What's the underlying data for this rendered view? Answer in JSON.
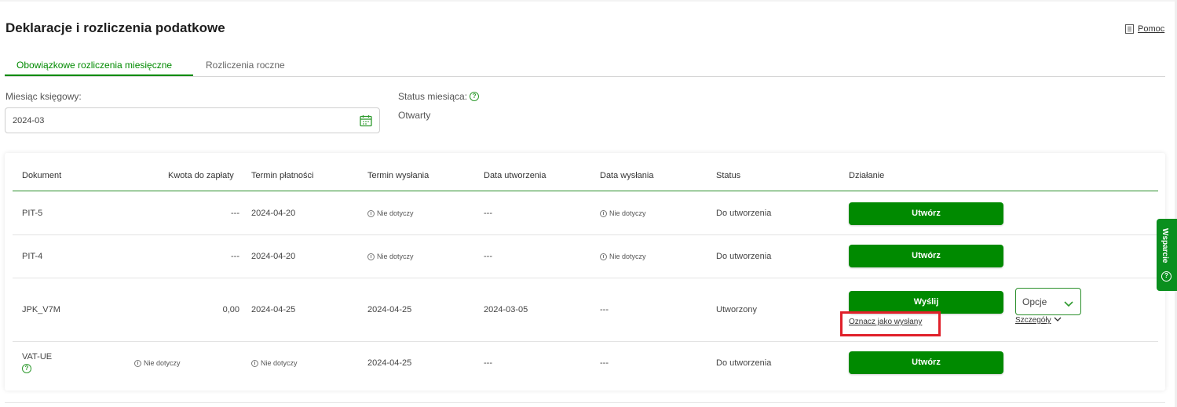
{
  "page": {
    "title": "Deklaracje i rozliczenia podatkowe",
    "help_label": "Pomoc"
  },
  "tabs": [
    {
      "label": "Obowiązkowe rozliczenia miesięczne",
      "active": true
    },
    {
      "label": "Rozliczenia roczne",
      "active": false
    }
  ],
  "filters": {
    "month_label": "Miesiąc księgowy:",
    "month_value": "2024-03",
    "status_label": "Status miesiąca:",
    "status_value": "Otwarty"
  },
  "table": {
    "headers": [
      "Dokument",
      "Kwota do zapłaty",
      "Termin płatności",
      "Termin wysłania",
      "Data utworzenia",
      "Data wysłania",
      "Status",
      "Działanie"
    ],
    "not_applicable": "Nie dotyczy",
    "rows": [
      {
        "document": "PIT-5",
        "amount": "---",
        "payment_deadline": "2024-04-20",
        "send_deadline": "Nie dotyczy",
        "created": "---",
        "sent": "Nie dotyczy",
        "status": "Do utworzenia",
        "action": "Utwórz"
      },
      {
        "document": "PIT-4",
        "amount": "---",
        "payment_deadline": "2024-04-20",
        "send_deadline": "Nie dotyczy",
        "created": "---",
        "sent": "Nie dotyczy",
        "status": "Do utworzenia",
        "action": "Utwórz"
      },
      {
        "document": "JPK_V7M",
        "amount": "0,00",
        "payment_deadline": "2024-04-25",
        "send_deadline": "2024-04-25",
        "created": "2024-03-05",
        "sent": "---",
        "status": "Utworzony",
        "action": "Wyślij",
        "mark_sent": "Oznacz jako wysłany",
        "options": "Opcje",
        "details": "Szczegóły"
      },
      {
        "document": "VAT-UE",
        "amount": "Nie dotyczy",
        "payment_deadline": "Nie dotyczy",
        "send_deadline": "2024-04-25",
        "created": "---",
        "sent": "---",
        "status": "Do utworzenia",
        "action": "Utwórz"
      }
    ]
  },
  "support": {
    "label": "Wsparcie"
  },
  "colors": {
    "accent": "#008a00",
    "highlight": "#e0202a"
  }
}
